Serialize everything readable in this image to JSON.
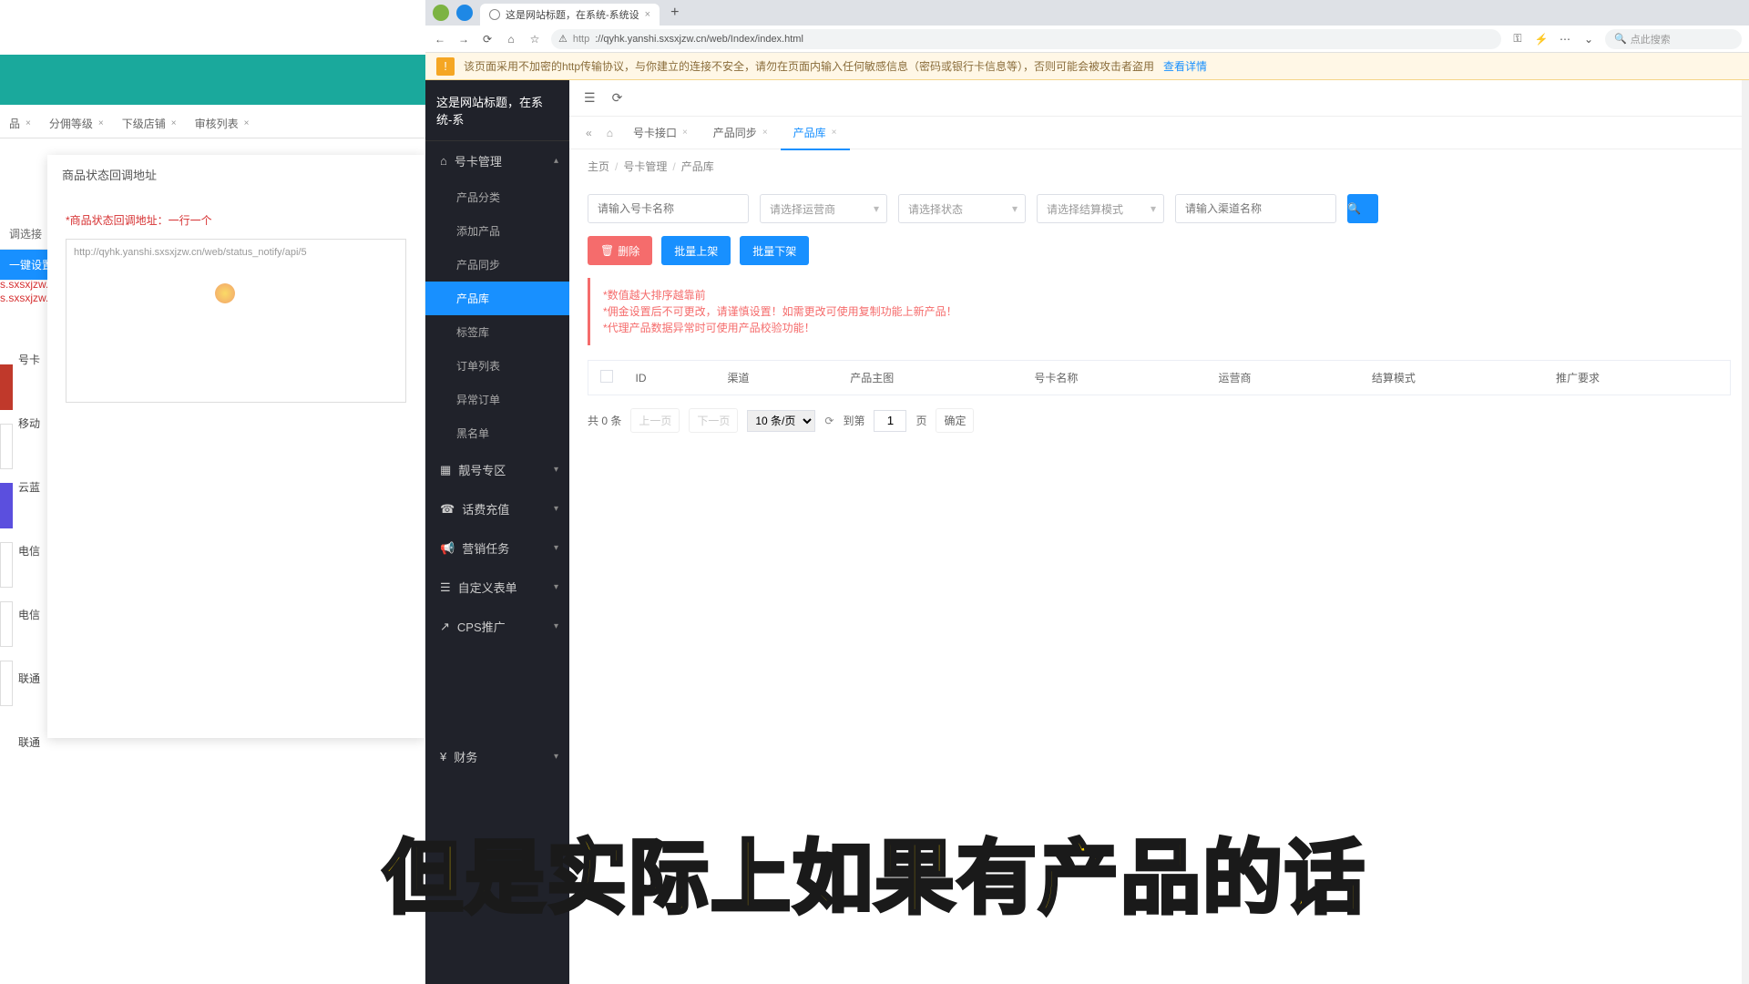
{
  "bg": {
    "tabs": [
      "品",
      "分佣等级",
      "下级店铺",
      "审核列表"
    ],
    "modal_title": "商品状态回调地址",
    "modal_required": "*商品状态回调地址：一行一个",
    "modal_value": "http://qyhk.yanshi.sxsxjzw.cn/web/status_notify/api/5",
    "side_items": [
      "调选接",
      "一键设置佣",
      "号卡",
      "移动\n（全",
      "云蓝",
      "电信",
      "电信",
      "联通",
      "联通"
    ],
    "red1": "s.sxsxjzw.cn",
    "red2": "s.sxsxjzw.cn"
  },
  "browser": {
    "tab_title": "这是网站标题，在系统-系统设",
    "url_protocol": "http",
    "url": "://qyhk.yanshi.sxsxjzw.cn/web/Index/index.html",
    "search_ph": "点此搜索",
    "warn_text": "该页面采用不加密的http传输协议，与你建立的连接不安全，请勿在页面内输入任何敏感信息（密码或银行卡信息等），否则可能会被攻击者盗用",
    "warn_link": "查看详情"
  },
  "side": {
    "title": "这是网站标题，在系统-系",
    "group1": "号卡管理",
    "subs": [
      "产品分类",
      "添加产品",
      "产品同步",
      "产品库",
      "标签库",
      "订单列表",
      "异常订单",
      "黑名单"
    ],
    "groups": [
      "靓号专区",
      "话费充值",
      "营销任务",
      "自定义表单",
      "CPS推广",
      "财务"
    ]
  },
  "tabs": [
    {
      "label": "号卡接口"
    },
    {
      "label": "产品同步"
    },
    {
      "label": "产品库"
    }
  ],
  "crumb": [
    "主页",
    "号卡管理",
    "产品库"
  ],
  "filters": {
    "f1_ph": "请输入号卡名称",
    "f2": "请选择运营商",
    "f3": "请选择状态",
    "f4": "请选择结算模式",
    "f5_ph": "请输入渠道名称"
  },
  "buttons": {
    "del": "删除",
    "up": "批量上架",
    "down": "批量下架"
  },
  "tips": [
    "*数值越大排序越靠前",
    "*佣金设置后不可更改，请谨慎设置！如需更改可使用复制功能上新产品！",
    "*代理产品数据异常时可使用产品校验功能！"
  ],
  "table": {
    "cols": [
      "ID",
      "渠道",
      "产品主图",
      "号卡名称",
      "运营商",
      "结算模式",
      "推广要求"
    ]
  },
  "pager": {
    "total": "共 0 条",
    "prev": "上一页",
    "next": "下一页",
    "size": "10 条/页",
    "goto": "到第",
    "page_unit": "页",
    "page": "1",
    "confirm": "确定"
  },
  "subtitle": "但是实际上如果有产品的话"
}
